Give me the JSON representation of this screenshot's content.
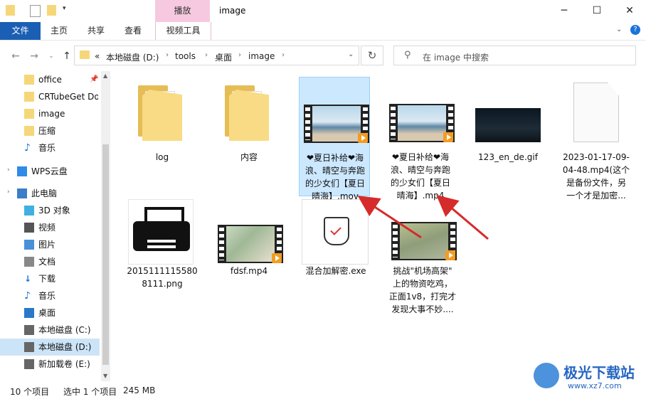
{
  "window": {
    "title": "image",
    "context_tab": "播放",
    "controls": {
      "minimize": "─",
      "maximize": "☐",
      "close": "✕"
    }
  },
  "ribbon": {
    "tabs": [
      "文件",
      "主页",
      "共享",
      "查看",
      "视频工具"
    ]
  },
  "address": {
    "prefix": "«",
    "crumbs": [
      "本地磁盘 (D:)",
      "tools",
      "桌面",
      "image"
    ]
  },
  "search": {
    "placeholder": "在 image 中搜索"
  },
  "nav": {
    "items": [
      {
        "label": "office",
        "icon": "folder-icon",
        "pinned": true
      },
      {
        "label": "CRTubeGet Do",
        "icon": "folder-icon"
      },
      {
        "label": "image",
        "icon": "folder-icon"
      },
      {
        "label": "压缩",
        "icon": "folder-icon"
      },
      {
        "label": "音乐",
        "icon": "music-icon"
      },
      {
        "label": "WPS云盘",
        "icon": "cloud-icon"
      },
      {
        "label": "此电脑",
        "icon": "computer-icon"
      },
      {
        "label": "3D 对象",
        "icon": "cube-icon"
      },
      {
        "label": "视频",
        "icon": "video-icon"
      },
      {
        "label": "图片",
        "icon": "picture-icon"
      },
      {
        "label": "文档",
        "icon": "document-icon"
      },
      {
        "label": "下载",
        "icon": "download-icon"
      },
      {
        "label": "音乐",
        "icon": "music-icon"
      },
      {
        "label": "桌面",
        "icon": "desktop-icon"
      },
      {
        "label": "本地磁盘 (C:)",
        "icon": "drive-icon"
      },
      {
        "label": "本地磁盘 (D:)",
        "icon": "drive-icon",
        "selected": true
      },
      {
        "label": "新加载卷 (E:)",
        "icon": "drive-icon"
      }
    ]
  },
  "files": [
    {
      "name": "log",
      "type": "folder"
    },
    {
      "name": "内容",
      "type": "folder"
    },
    {
      "name": "❤夏日补给❤海浪、晴空与奔跑的少女们【夏日晴海】.mov",
      "type": "video",
      "selected": true
    },
    {
      "name": "❤夏日补给❤海浪、晴空与奔跑的少女们【夏日晴海】.mp4",
      "type": "video"
    },
    {
      "name": "123_en_de.gif",
      "type": "image"
    },
    {
      "name": "2023-01-17-09-04-48.mp4(这个是备份文件，另一个才是加密...",
      "type": "file"
    },
    {
      "name": "20151111155808111.png",
      "type": "image"
    },
    {
      "name": "fdsf.mp4",
      "type": "video"
    },
    {
      "name": "混合加解密.exe",
      "type": "exe"
    },
    {
      "name": "挑战\"机场高架\"上的物资吃鸡，正面1v8，打完才发现大事不妙....",
      "type": "video"
    }
  ],
  "labels": {
    "f0": "log",
    "f1": "内容",
    "f2": [
      "❤夏日补给❤海",
      "浪、晴空与奔跑",
      "的少女们【夏日",
      "晴海】.mov"
    ],
    "f3": [
      "❤夏日补给❤海",
      "浪、晴空与奔跑",
      "的少女们【夏日",
      "晴海】.mp4"
    ],
    "f4": "123_en_de.gif",
    "f5": [
      "2023-01-17-09-",
      "04-48.mp4(这个",
      "是备份文件，另",
      "一个才是加密..."
    ],
    "f6": [
      "2015111115580",
      "8111.png"
    ],
    "f7": "fdsf.mp4",
    "f8": "混合加解密.exe",
    "f9": [
      "挑战\"机场高架\"",
      "上的物资吃鸡，",
      "正面1v8，打完才",
      "发现大事不妙...."
    ]
  },
  "status": {
    "count": "10 个项目",
    "selection": "选中 1 个项目",
    "size": "245 MB"
  },
  "watermark": {
    "text": "极光下载站",
    "url": "www.xz7.com"
  },
  "colors": {
    "accent": "#1a5fb4",
    "context_tab": "#f6c9e0",
    "selection": "#cce8ff",
    "arrow": "#d62b2b"
  }
}
